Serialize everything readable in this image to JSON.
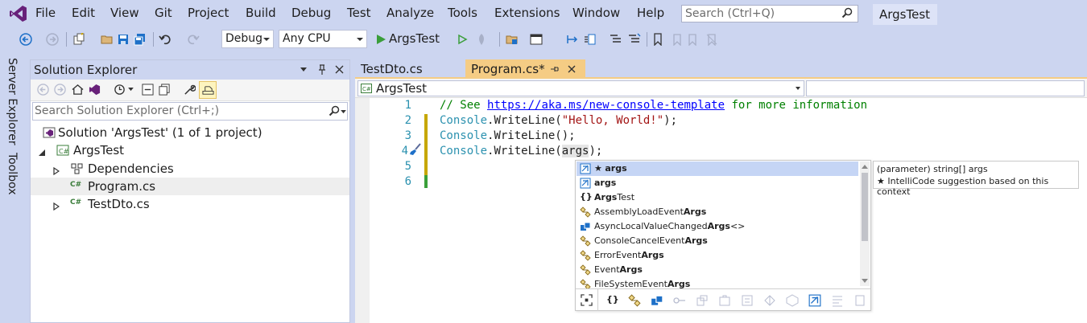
{
  "app": {
    "title": "ArgsTest",
    "search_placeholder": "Search (Ctrl+Q)",
    "accent": "#68217a"
  },
  "menu": [
    "File",
    "Edit",
    "View",
    "Git",
    "Project",
    "Build",
    "Debug",
    "Test",
    "Analyze",
    "Tools",
    "Extensions",
    "Window",
    "Help"
  ],
  "toolbar": {
    "config": "Debug",
    "platform": "Any CPU",
    "run_label": "ArgsTest"
  },
  "side_tabs": [
    "Server Explorer",
    "Toolbox"
  ],
  "solution_explorer": {
    "title": "Solution Explorer",
    "search_placeholder": "Search Solution Explorer (Ctrl+;)",
    "tree": [
      {
        "label": "Solution 'ArgsTest' (1 of 1 project)",
        "icon": "solution-icon"
      },
      {
        "label": "ArgsTest",
        "icon": "csharp-project-icon"
      },
      {
        "label": "Dependencies",
        "icon": "dependencies-icon"
      },
      {
        "label": "Program.cs",
        "icon": "csharp-file-icon"
      },
      {
        "label": "TestDto.cs",
        "icon": "csharp-file-icon"
      }
    ]
  },
  "editor": {
    "tabs": [
      {
        "label": "TestDto.cs",
        "active": false
      },
      {
        "label": "Program.cs*",
        "active": true
      }
    ],
    "nav_scope": "ArgsTest",
    "lines": [
      {
        "num": "1",
        "comment": "// See ",
        "link": "https://aka.ms/new-console-template",
        "tail": " for more information"
      },
      {
        "num": "2",
        "cls": "Console",
        "member": ".WriteLine(",
        "str": "\"Hello, World!\"",
        "end": ");"
      },
      {
        "num": "3",
        "cls": "Console",
        "member": ".WriteLine();"
      },
      {
        "num": "4",
        "cls": "Console",
        "member": ".WriteLine(",
        "arg": "args",
        "end": ");"
      },
      {
        "num": "5"
      },
      {
        "num": "6"
      }
    ]
  },
  "completion": {
    "items": [
      {
        "prefix": "★ ",
        "bold": "args",
        "rest": "",
        "icon": "parameter-icon",
        "selected": true
      },
      {
        "prefix": "",
        "bold": "args",
        "rest": "",
        "icon": "parameter-icon"
      },
      {
        "prefix": "",
        "bold": "Args",
        "rest": "Test",
        "icon": "namespace-icon"
      },
      {
        "prefix": "AssemblyLoadEvent",
        "bold": "Args",
        "rest": "",
        "icon": "class-icon"
      },
      {
        "prefix": "AsyncLocalValueChanged",
        "bold": "Args",
        "rest": "<>",
        "icon": "struct-icon"
      },
      {
        "prefix": "ConsoleCancelEvent",
        "bold": "Args",
        "rest": "",
        "icon": "class-icon"
      },
      {
        "prefix": "ErrorEvent",
        "bold": "Args",
        "rest": "",
        "icon": "class-icon"
      },
      {
        "prefix": "Event",
        "bold": "Args",
        "rest": "",
        "icon": "class-icon"
      },
      {
        "prefix": "FileSystemEvent",
        "bold": "Args",
        "rest": "",
        "icon": "class-icon"
      }
    ],
    "tooltip": {
      "line1": "(parameter) string[] args",
      "line2": "★  IntelliCode suggestion based on this context"
    }
  }
}
